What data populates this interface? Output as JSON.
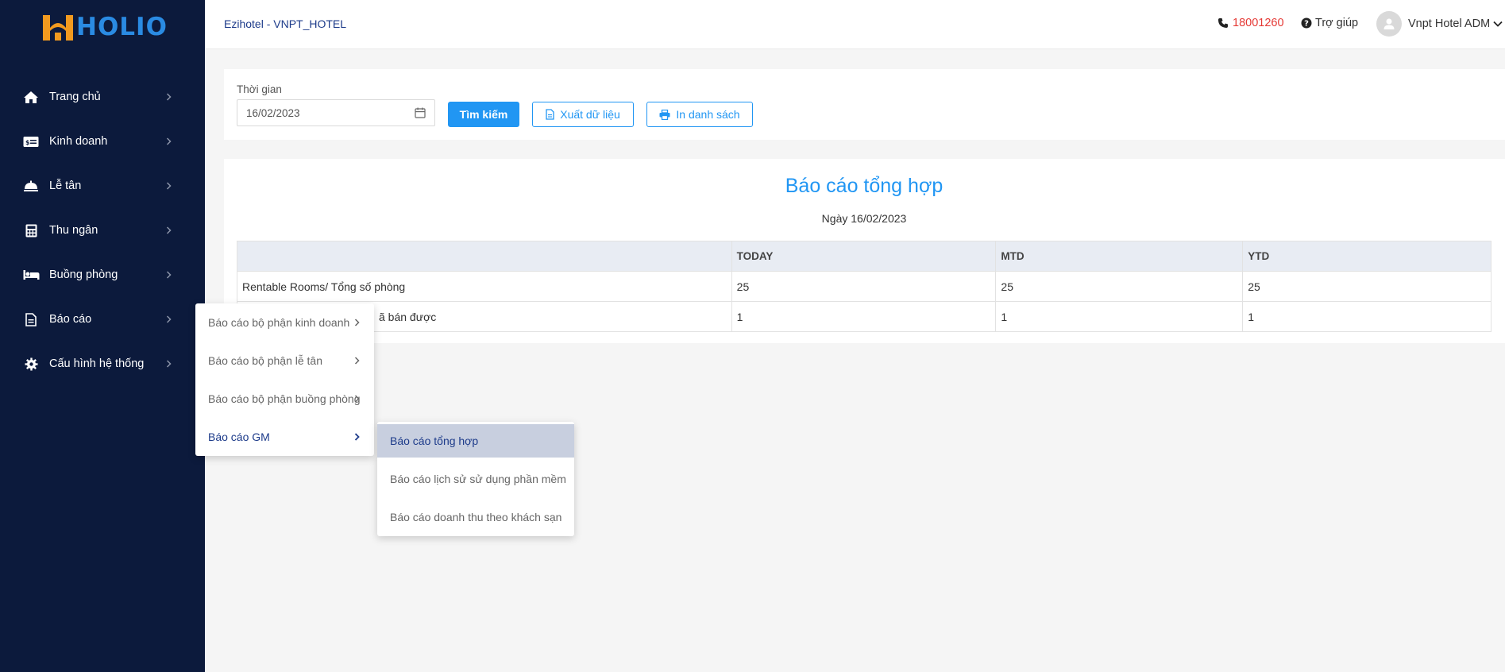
{
  "brand": {
    "name": "HOLIO",
    "primary": "#2196f3",
    "sidebar_bg": "#0c1a3c",
    "logo_accent": "#f29a1f"
  },
  "sidebar": {
    "items": [
      {
        "label": "Trang chủ",
        "icon": "home-icon"
      },
      {
        "label": "Kinh doanh",
        "icon": "money-card-icon"
      },
      {
        "label": "Lễ tân",
        "icon": "bell-icon"
      },
      {
        "label": "Thu ngân",
        "icon": "calculator-icon"
      },
      {
        "label": "Buồng phòng",
        "icon": "bed-icon"
      },
      {
        "label": "Báo cáo",
        "icon": "file-icon"
      },
      {
        "label": "Cấu hình hệ thống",
        "icon": "gear-icon"
      }
    ]
  },
  "header": {
    "hotel": "Ezihotel - VNPT_HOTEL",
    "phone": "18001260",
    "help": "Trợ giúp",
    "user": "Vnpt Hotel ADM"
  },
  "filter": {
    "label": "Thời gian",
    "date_value": "16/02/2023",
    "search_label": "Tìm kiếm",
    "export_label": "Xuất dữ liệu",
    "print_label": "In danh sách"
  },
  "report": {
    "title": "Báo cáo tổng hợp",
    "date": "Ngày 16/02/2023",
    "columns": [
      "",
      "TODAY",
      "MTD",
      "YTD"
    ],
    "rows": [
      [
        "Rentable Rooms/ Tổng số phòng",
        "25",
        "25",
        "25"
      ],
      [
        "ã bán được",
        "1",
        "1",
        "1"
      ]
    ]
  },
  "menu_reports": {
    "items": [
      "Báo cáo bộ phận kinh doanh",
      "Báo cáo bộ phận lễ tân",
      "Báo cáo bộ phận buồng phòng",
      "Báo cáo GM"
    ]
  },
  "menu_gm": {
    "items": [
      "Báo cáo tổng hợp",
      "Báo cáo lịch sử sử dụng phần mềm",
      "Báo cáo doanh thu theo khách sạn"
    ]
  }
}
